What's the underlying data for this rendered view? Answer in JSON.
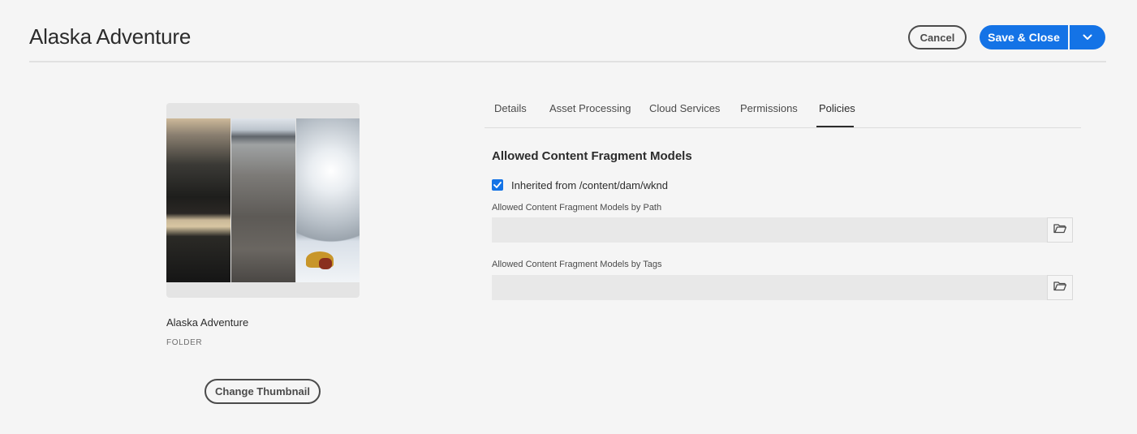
{
  "header": {
    "title": "Alaska Adventure",
    "cancel_label": "Cancel",
    "save_label": "Save & Close"
  },
  "asset": {
    "name": "Alaska Adventure",
    "type": "FOLDER",
    "change_thumbnail_label": "Change Thumbnail"
  },
  "tabs": [
    {
      "label": "Details",
      "selected": false
    },
    {
      "label": "Asset Processing",
      "selected": false
    },
    {
      "label": "Cloud Services",
      "selected": false
    },
    {
      "label": "Permissions",
      "selected": false
    },
    {
      "label": "Policies",
      "selected": true
    }
  ],
  "policies": {
    "section_title": "Allowed Content Fragment Models",
    "inherited_label": "Inherited from /content/dam/wknd",
    "inherited_checked": true,
    "by_path_label": "Allowed Content Fragment Models by Path",
    "by_path_value": "",
    "by_tags_label": "Allowed Content Fragment Models by Tags",
    "by_tags_value": ""
  },
  "colors": {
    "accent": "#1473e6",
    "background": "#f5f5f5"
  },
  "icons": {
    "save_menu": "chevron-down-icon",
    "checkbox": "checkmark-icon",
    "browse": "folder-open-icon"
  }
}
